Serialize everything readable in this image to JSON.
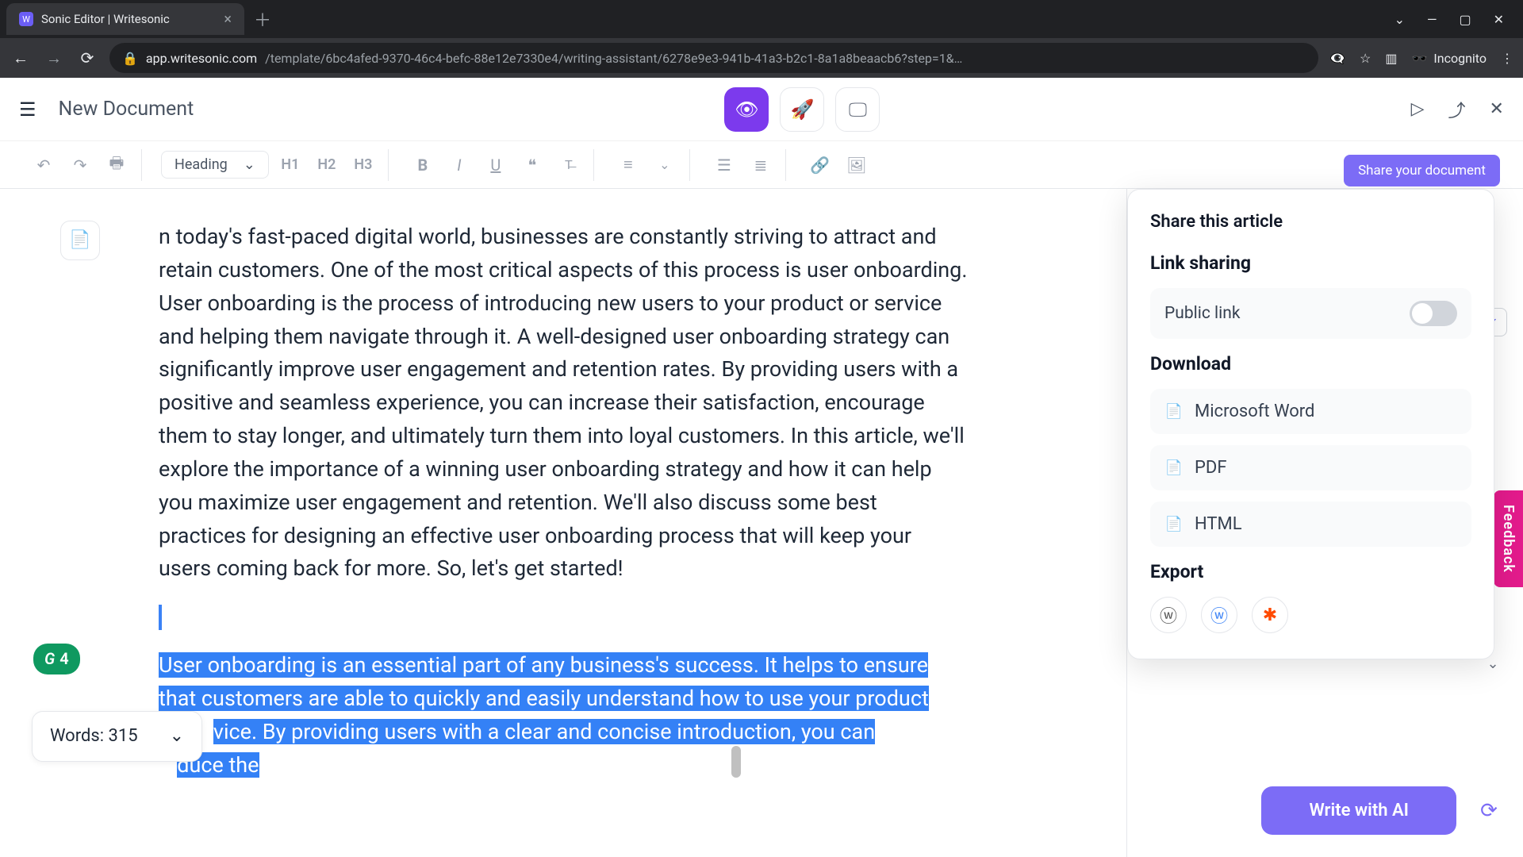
{
  "browser": {
    "tab_title": "Sonic Editor | Writesonic",
    "url_prefix": "app.writesonic.com",
    "url_rest": "/template/6bc4afed-9370-46c4-befc-88e12e7330e4/writing-assistant/6278e9e3-941b-41a3-b2c1-8a1a8beaacb6?step=1&…",
    "incognito": "Incognito"
  },
  "header": {
    "title": "New Document"
  },
  "toolbar": {
    "style": "Heading",
    "h1": "H1",
    "h2": "H2",
    "h3": "H3",
    "quote": "❝"
  },
  "editor": {
    "para1": "n today's fast-paced digital world, businesses are constantly striving to attract and retain customers. One of the most critical aspects of this process is user onboarding. User onboarding is the process of introducing new users to your product or service and helping them navigate through it. A well-designed user onboarding strategy can significantly improve user engagement and retention rates. By providing users with a positive and seamless experience, you can increase their satisfaction, encourage them to stay longer, and ultimately turn them into loyal customers. In this article, we'll explore the importance of a winning user onboarding strategy and how it can help you maximize user engagement and retention. We'll also discuss some best practices for designing an effective user onboarding process that will keep your users coming back for more. So, let's get started!",
    "sel_part": "User onboarding is an essential part of any business's success. It helps to ensure that customers are able to quickly and easily understand how to use your product",
    "sel_frag2a": "vice.",
    "sel_frag2b": " By providing users with a clear and concise introduction, you can",
    "sel_frag3": "duce the"
  },
  "words": {
    "label": "Words: 315"
  },
  "grammarly": {
    "count": "4"
  },
  "share": {
    "title": "Share this article",
    "tooltip": "Share your document",
    "link_section": "Link sharing",
    "public_link": "Public link",
    "download": "Download",
    "word": "Microsoft Word",
    "pdf": "PDF",
    "html": "HTML",
    "export": "Export"
  },
  "actions": {
    "write": "Write with AI"
  },
  "feedback": "Feedback"
}
